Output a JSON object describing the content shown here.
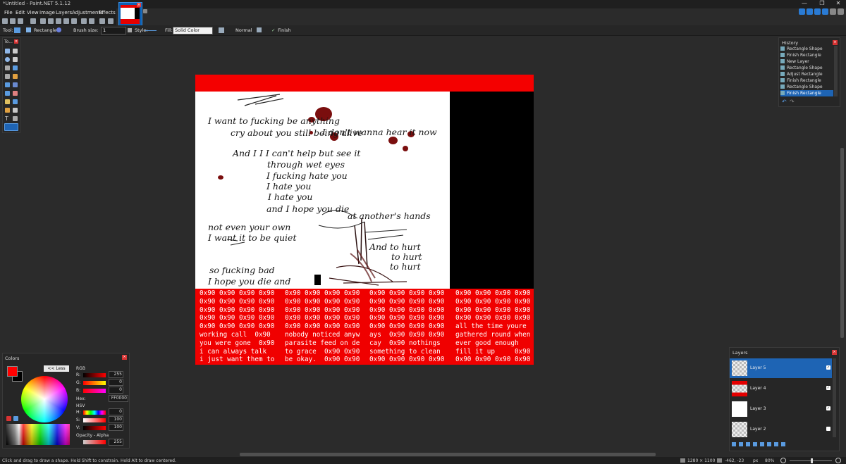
{
  "window": {
    "title": "*Untitled - Paint.NET 5.1.12",
    "minimize": "—",
    "maximize": "❐",
    "close": "✕"
  },
  "menu": [
    "File",
    "Edit",
    "View",
    "Image",
    "Layers",
    "Adjustments",
    "Effects"
  ],
  "toolbar": {
    "tool_label": "Tool:",
    "shape": "Rectangle",
    "brush_size_label": "Brush size:",
    "brush_size": "1",
    "style_label": "Style:",
    "fill_label": "Fill:",
    "fill": "Solid Color",
    "blend_mode": "Normal",
    "finish": "Finish"
  },
  "tools_panel": {
    "title": "To..."
  },
  "canvas": {
    "hex_columns": [
      "0x90 0x90 0x90 0x90\n0x90 0x90 0x90 0x90\n0x90 0x90 0x90 0x90\n0x90 0x90 0x90 0x90\n0x90 0x90 0x90 0x90\nworking call  0x90\nyou were gone  0x90\ni can always talk\ni just want them to",
      "0x90 0x90 0x90 0x90\n0x90 0x90 0x90 0x90\n0x90 0x90 0x90 0x90\n0x90 0x90 0x90 0x90\n0x90 0x90 0x90 0x90\nnobody noticed anyw\nparasite feed on de\nto grace  0x90 0x90\nbe okay.  0x90 0x90",
      "0x90 0x90 0x90 0x90\n0x90 0x90 0x90 0x90\n0x90 0x90 0x90 0x90\n0x90 0x90 0x90 0x90\n0x90 0x90 0x90 0x90\nays  0x90 0x90 0x90\ncay  0x90 nothings\nsomething to clean\n0x90 0x90 0x90 0x90",
      "0x90 0x90 0x90 0x90\n0x90 0x90 0x90 0x90\n0x90 0x90 0x90 0x90\n0x90 0x90 0x90 0x90\nall the time youre\ngathered round when\never good enough\nfill it up     0x90\n0x90 0x90 0x90 0x90"
    ],
    "lyrics": [
      "I want to fucking be anything",
      "cry about you still being alive",
      "I don't wanna hear it now",
      "And I I I can't help but see it",
      "through wet eyes",
      "I fucking hate you",
      "I hate you",
      "I hate you",
      "and I hope you die",
      "at another's hands",
      "not even your own",
      "I want it to be quiet",
      "And to hurt",
      "to hurt",
      "to hurt",
      "so fucking bad",
      "I hope you die and"
    ]
  },
  "history": {
    "title": "History",
    "items": [
      "Rectangle Shape",
      "Finish Rectangle",
      "New Layer",
      "Rectangle Shape",
      "Adjust Rectangle",
      "Finish Rectangle",
      "Rectangle Shape",
      "Finish Rectangle"
    ]
  },
  "colors": {
    "title": "Colors",
    "less_button": "<< Less",
    "rgb_label": "RGB",
    "r_label": "R:",
    "r_value": "255",
    "g_label": "G:",
    "g_value": "0",
    "b_label": "B:",
    "b_value": "0",
    "hex_label": "Hex:",
    "hex_value": "FF0000",
    "hsv_label": "HSV",
    "h_label": "H:",
    "h_value": "0",
    "s_label": "S:",
    "s_value": "100",
    "v_label": "V:",
    "v_value": "100",
    "opacity_label": "Opacity - Alpha",
    "opacity_value": "255",
    "primary_color": "#ff0000",
    "secondary_color": "#000000"
  },
  "layers": {
    "title": "Layers",
    "items": [
      {
        "name": "Layer 5",
        "visible": true,
        "selected": true
      },
      {
        "name": "Layer 4",
        "visible": true,
        "selected": false
      },
      {
        "name": "Layer 3",
        "visible": true,
        "selected": false
      },
      {
        "name": "Layer 2",
        "visible": false,
        "selected": false
      }
    ]
  },
  "status": {
    "hint": "Click and drag to draw a shape. Hold Shift to constrain. Hold Alt to draw centered.",
    "image_size": "1280 × 1100",
    "cursor": "-462, -23",
    "units": "px",
    "zoom": "80%"
  }
}
